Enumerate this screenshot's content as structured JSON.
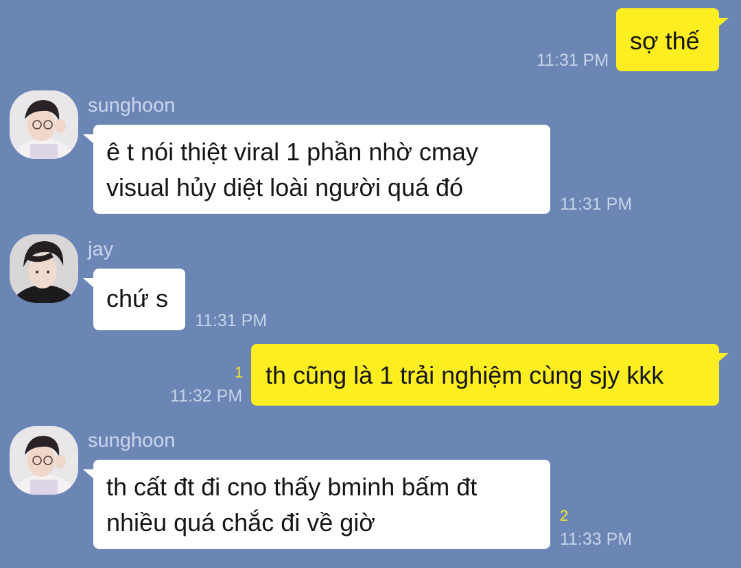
{
  "messages": [
    {
      "sender": "me",
      "text": "sợ thế",
      "time": "11:31 PM"
    },
    {
      "sender": "sunghoon",
      "name": "sunghoon",
      "text": "ê t nói thiệt viral 1 phần nhờ cmay\nvisual hủy diệt loài người quá đó",
      "time": "11:31 PM"
    },
    {
      "sender": "jay",
      "name": "jay",
      "text": "chứ s",
      "time": "11:31 PM"
    },
    {
      "sender": "me",
      "text": "th cũng là 1 trải nghiệm cùng sjy kkk",
      "time": "11:32 PM",
      "unread": "1"
    },
    {
      "sender": "sunghoon",
      "name": "sunghoon",
      "text": "th cất đt đi cno thấy bminh bấm đt\nnhiều quá chắc đi về giờ",
      "time": "11:33 PM",
      "unread": "2"
    }
  ],
  "colors": {
    "background": "#6b86b5",
    "my_bubble": "#fcee21",
    "their_bubble": "#ffffff",
    "timestamp": "#c6d3ea",
    "unread_count": "#f6e92b"
  }
}
